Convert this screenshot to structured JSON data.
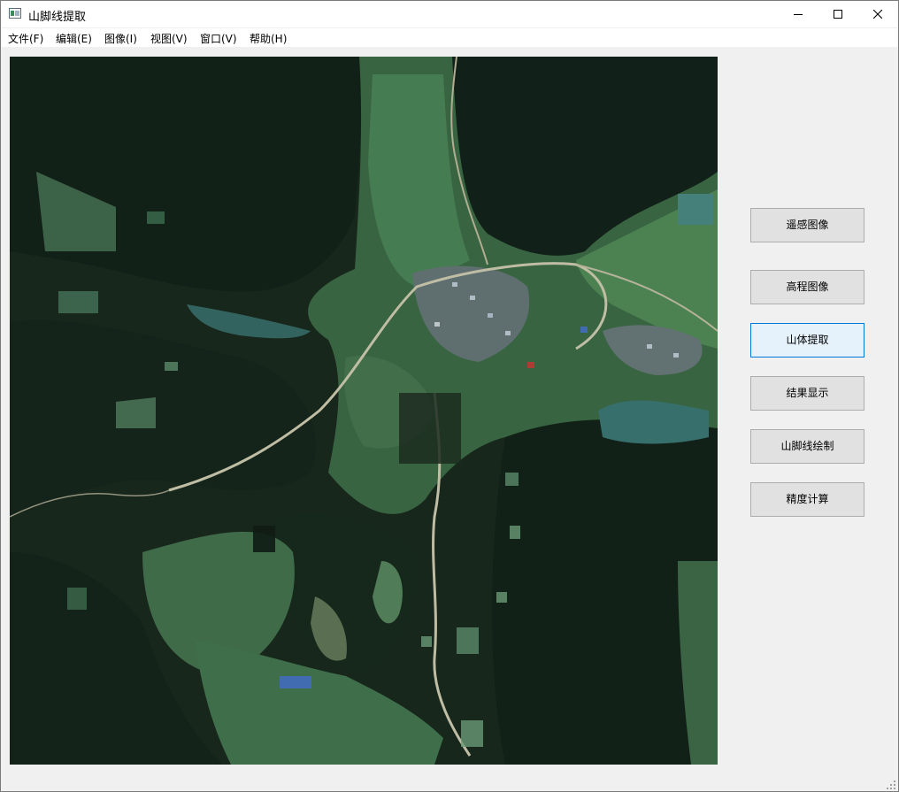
{
  "window": {
    "title": "山脚线提取",
    "app_icon": "image-app-icon",
    "controls": [
      "minimize-icon",
      "maximize-icon",
      "close-icon"
    ]
  },
  "menu": {
    "items": [
      {
        "label": "文件(F)"
      },
      {
        "label": "编辑(E)"
      },
      {
        "label": "图像(I)"
      },
      {
        "label": "视图(V)"
      },
      {
        "label": "窗口(V)"
      },
      {
        "label": "帮助(H)"
      }
    ]
  },
  "viewer": {
    "content": "satellite-image-with-mountain-overlay",
    "colors": {
      "forest_dark": "#1a2a1e",
      "mountain_shade": "#1f3324",
      "farmland": "#4f8a5a",
      "road": "#d9d4b8",
      "water": "#3d7c78",
      "roof_blue": "#4a78c8"
    }
  },
  "sidebar": {
    "buttons": [
      {
        "label": "遥感图像",
        "active": false
      },
      {
        "label": "高程图像",
        "active": false
      },
      {
        "label": "山体提取",
        "active": true
      },
      {
        "label": "结果显示",
        "active": false
      },
      {
        "label": "山脚线绘制",
        "active": false
      },
      {
        "label": "精度计算",
        "active": false
      }
    ],
    "colors": {
      "button_bg": "#e1e1e1",
      "active_bg": "#e5f1fb",
      "active_border": "#0078d7"
    }
  }
}
